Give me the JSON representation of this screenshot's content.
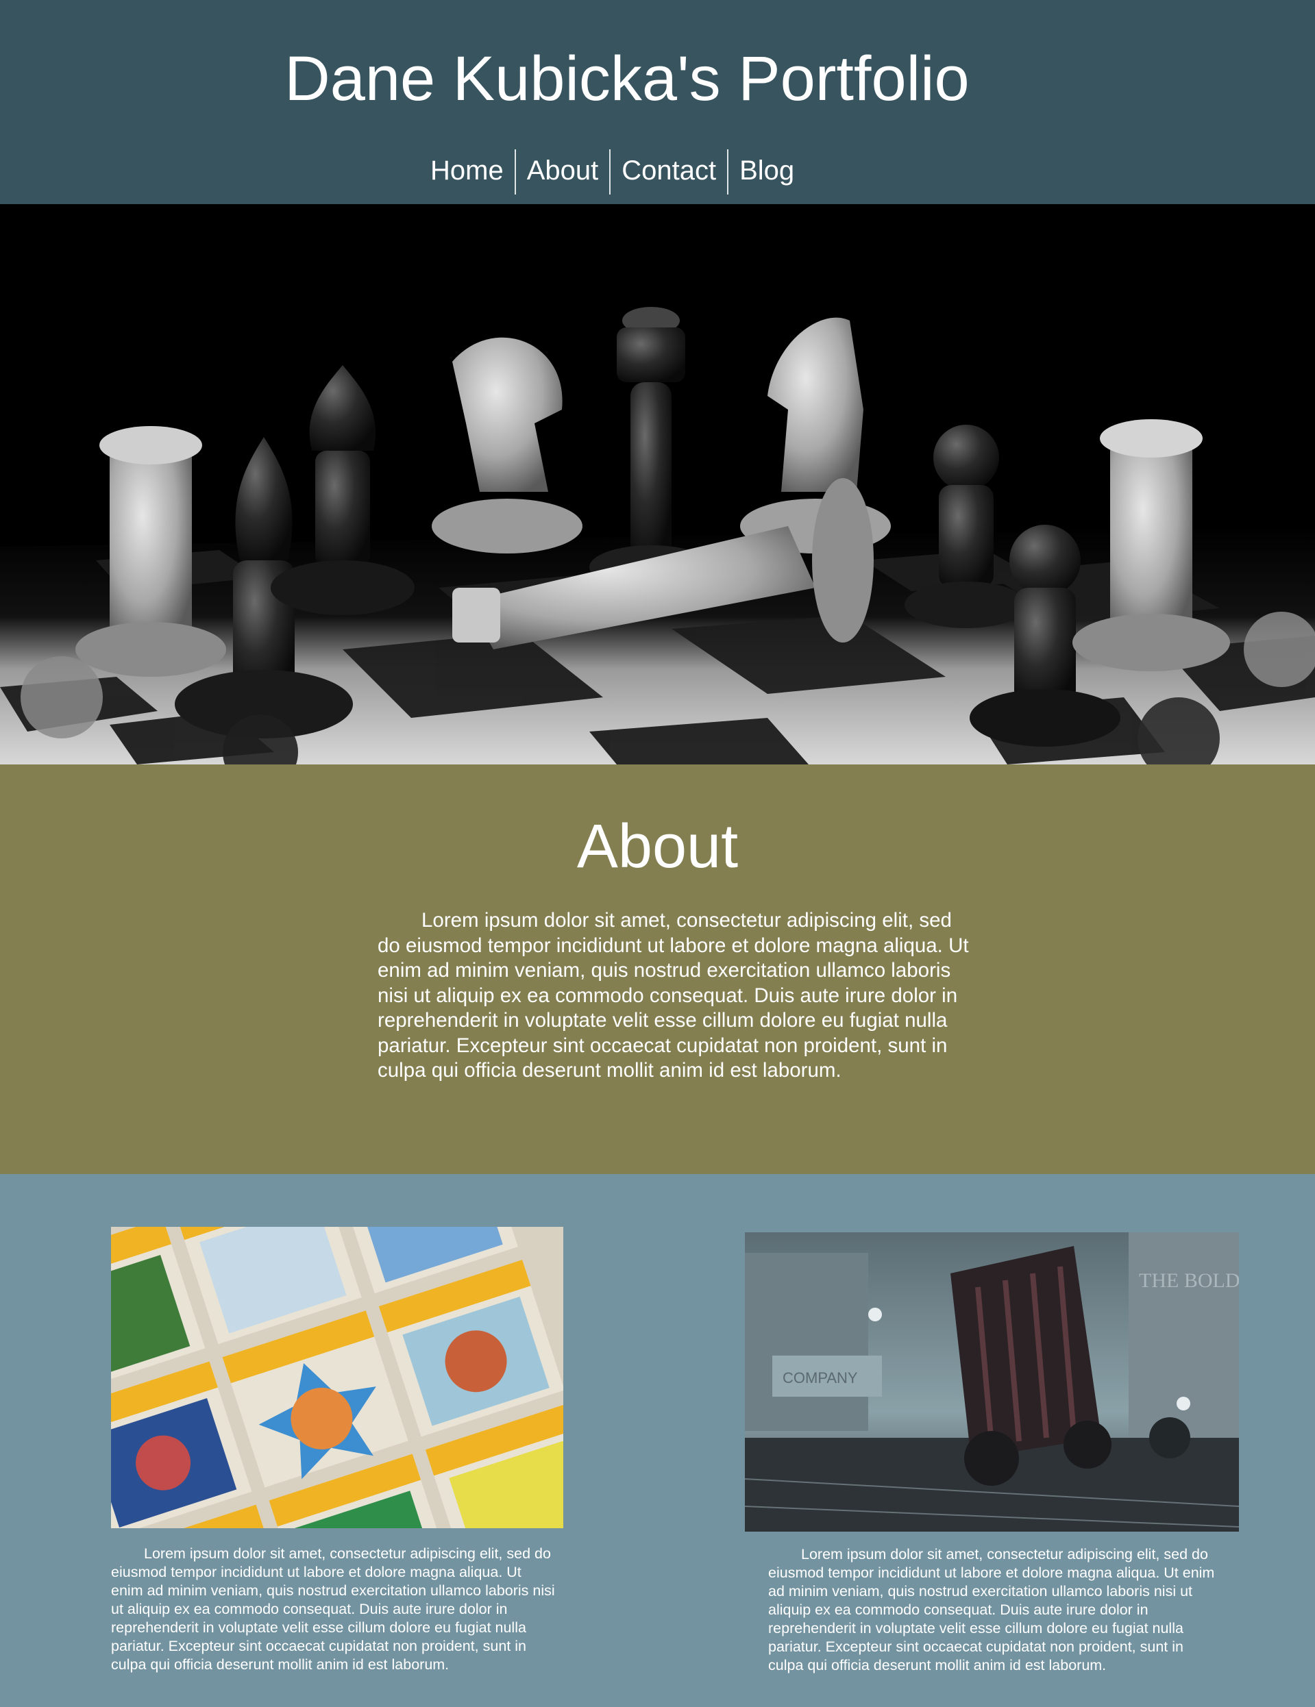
{
  "header": {
    "title": "Dane Kubicka's Portfolio",
    "nav": [
      {
        "label": "Home"
      },
      {
        "label": "About"
      },
      {
        "label": "Contact"
      },
      {
        "label": "Blog"
      }
    ]
  },
  "hero": {
    "image": "chess-pieces-photo"
  },
  "about": {
    "title": "About",
    "text": "Lorem ipsum dolor sit amet, consectetur adipiscing elit, sed do eiusmod tempor incididunt ut labore et dolore magna aliqua. Ut enim ad minim veniam, quis nostrud exercitation ullamco laboris nisi ut aliquip ex ea commodo consequat. Duis aute irure dolor in reprehenderit in voluptate velit esse cillum dolore eu fugiat nulla pariatur. Excepteur sint occaecat cupidatat non proident, sunt in culpa qui officia deserunt mollit anim id est laborum."
  },
  "gallery": [
    {
      "image": "famicom-game-boxes-photo",
      "text": "Lorem ipsum dolor sit amet, consectetur adipiscing elit, sed do eiusmod tempor incididunt ut labore et dolore magna aliqua. Ut enim ad minim veniam, quis nostrud exercitation ullamco laboris nisi ut aliquip ex ea commodo consequat. Duis aute irure dolor in reprehenderit in voluptate velit esse cillum dolore eu fugiat nulla pariatur. Excepteur sint occaecat cupidatat non proident, sunt in culpa qui officia deserunt mollit anim id est laborum."
    },
    {
      "image": "steampunk-vehicle-painting",
      "sign_text_company": "COMPANY",
      "sign_text_boldest": "THE BOLDEST MEASURES",
      "text": "Lorem ipsum dolor sit amet, consectetur adipiscing elit, sed do eiusmod tempor incididunt ut labore et dolore magna aliqua. Ut enim ad minim veniam, quis nostrud exercitation ullamco laboris nisi ut aliquip ex ea commodo consequat. Duis aute irure dolor in reprehenderit in voluptate velit esse cillum dolore eu fugiat nulla pariatur. Excepteur sint occaecat cupidatat non proident, sunt in culpa qui officia deserunt mollit anim id est laborum."
    }
  ],
  "colors": {
    "header_bg": "#38545e",
    "about_bg": "#837f50",
    "gallery_bg": "#7393a0",
    "text": "#ffffff"
  }
}
